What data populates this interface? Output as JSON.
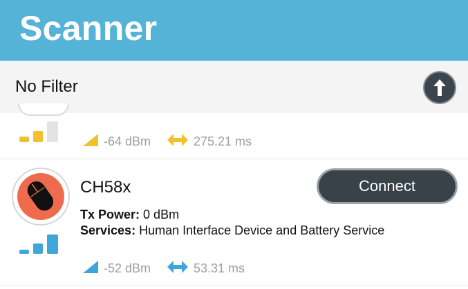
{
  "header": {
    "title": "Scanner"
  },
  "filter": {
    "label": "No Filter"
  },
  "devices": [
    {
      "rssi": "-64 dBm",
      "interval": "275.21 ms",
      "signal_color": "#f2c12e"
    },
    {
      "name": "CH58x",
      "connect_label": "Connect",
      "tx_power_label": "Tx Power:",
      "tx_power_value": "0 dBm",
      "services_label": "Services:",
      "services_value": "Human Interface Device and Battery Service",
      "rssi": "-52 dBm",
      "interval": "53.31 ms",
      "signal_color": "#3ea6d8",
      "icon": "mouse-icon"
    }
  ],
  "colors": {
    "header": "#55b3d8",
    "button": "#394249",
    "avatar_bg": "#ee6c4d"
  }
}
